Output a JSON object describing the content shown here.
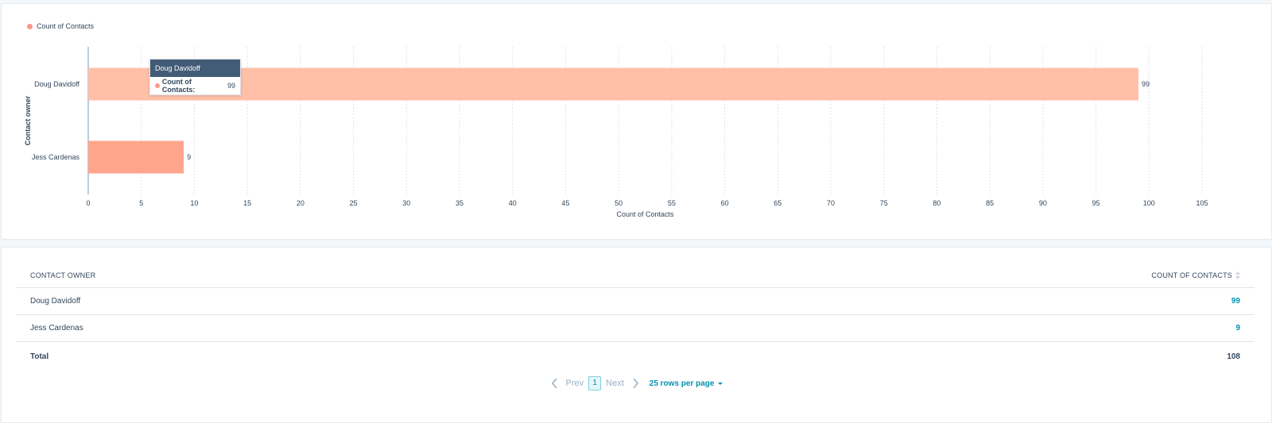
{
  "colors": {
    "bar_primary": "#ffbfa8",
    "bar_secondary": "#ffa58d",
    "legend_dot": "#f7988a",
    "link": "#0091ae",
    "tooltip_header": "#425b76"
  },
  "legend": {
    "label": "Count of Contacts"
  },
  "tooltip": {
    "title": "Doug Davidoff",
    "metric_label": "Count of Contacts:",
    "metric_value": "99"
  },
  "chart_data": {
    "type": "bar",
    "orientation": "horizontal",
    "categories": [
      "Doug Davidoff",
      "Jess Cardenas"
    ],
    "values": [
      99,
      9
    ],
    "series": [
      {
        "name": "Count of Contacts",
        "values": [
          99,
          9
        ]
      }
    ],
    "xlabel": "Count of Contacts",
    "ylabel": "Contact owner",
    "xlim": [
      0,
      105
    ],
    "xticks": [
      0,
      5,
      10,
      15,
      20,
      25,
      30,
      35,
      40,
      45,
      50,
      55,
      60,
      65,
      70,
      75,
      80,
      85,
      90,
      95,
      100,
      105
    ],
    "grid": true,
    "legend_position": "top-left"
  },
  "table": {
    "headers": {
      "owner": "CONTACT OWNER",
      "count": "COUNT OF CONTACTS"
    },
    "rows": [
      {
        "owner": "Doug Davidoff",
        "count": "99"
      },
      {
        "owner": "Jess Cardenas",
        "count": "9"
      }
    ],
    "total": {
      "label": "Total",
      "value": "108"
    }
  },
  "pagination": {
    "prev": "Prev",
    "next": "Next",
    "current_page": "1",
    "rows_per_page": "25 rows per page"
  }
}
